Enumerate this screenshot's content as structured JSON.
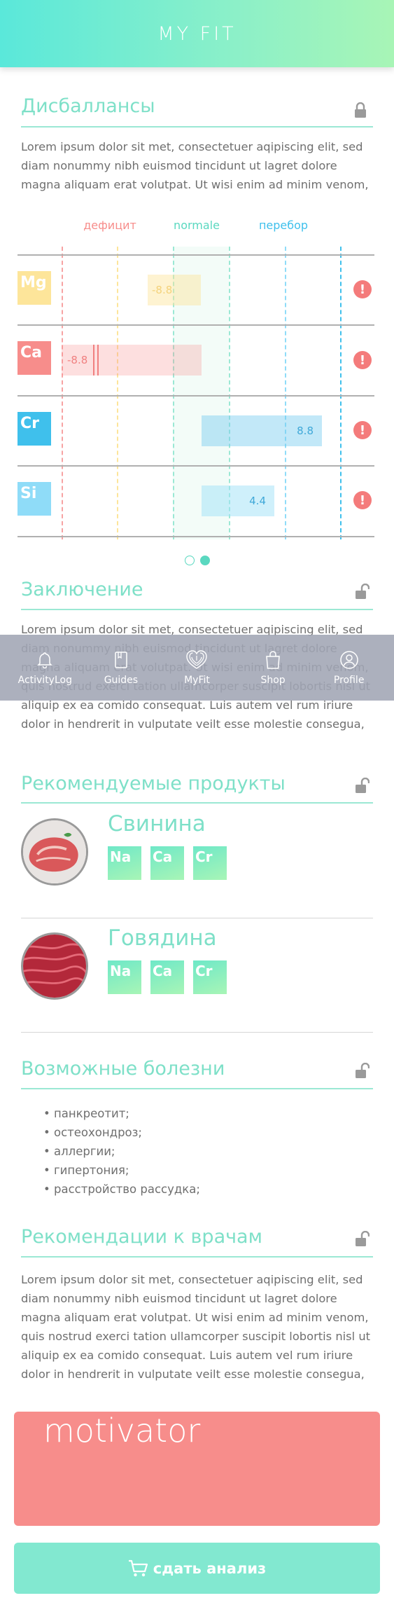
{
  "header": {
    "title": "MY FIT"
  },
  "imbalances": {
    "title": "Дисбаллансы",
    "text": "Lorem ipsum dolor sit met, consectetuer aqipiscing elit, sed diam nonummy nibh euismod tincidunt ut lagret dolore magna aliquam erat volutpat. Ut wisi enim ad minim venom,",
    "zones": {
      "deficit": "дефицит",
      "normal": "normale",
      "excess": "перебор"
    },
    "rows": [
      {
        "element": "Mg",
        "value": "-8.8",
        "color": "#fde59a"
      },
      {
        "element": "Ca",
        "value": "-8.8",
        "color": "#f78d8b"
      },
      {
        "element": "Cr",
        "value": "8.8",
        "color": "#3fc0ec"
      },
      {
        "element": "Si",
        "value": "4.4",
        "color": "#8fdcf8"
      }
    ],
    "warning_icon": "!"
  },
  "conclusion": {
    "title": "Заключение",
    "text": "Lorem ipsum dolor sit met, consectetuer aqipiscing elit, sed diam nonummy nibh euismod tincidunt ut lagret dolore magna aliquam erat volutpat. Ut wisi enim ad minim venom, quis nostrud exerci tation ullamcorper suscipit lobortis nisl ut aliquip ex ea comido consequat. Luis autem vel rum iriure dolor in hendrerit in vulputate veilt esse molestie consegua, vel"
  },
  "nav": [
    {
      "label": "ActivityLog",
      "icon": "bell-icon"
    },
    {
      "label": "Guides",
      "icon": "book-icon"
    },
    {
      "label": "MyFit",
      "icon": "fingerprint-icon"
    },
    {
      "label": "Shop",
      "icon": "bag-icon"
    },
    {
      "label": "Profile",
      "icon": "user-icon"
    }
  ],
  "products": {
    "title": "Рекомендуемые продукты",
    "items": [
      {
        "name": "Свинина",
        "badges": [
          "Na",
          "Ca",
          "Cr"
        ]
      },
      {
        "name": "Говядина",
        "badges": [
          "Na",
          "Ca",
          "Cr"
        ]
      }
    ]
  },
  "diseases": {
    "title": "Возможные болезни",
    "items": [
      "панкреотит;",
      "остеохондроз;",
      "аллергии;",
      "гипертония;",
      "расстройство рассудка;"
    ]
  },
  "doctors": {
    "title": "Рекомендации к врачам",
    "text": "Lorem ipsum dolor sit met, consectetuer aqipiscing elit, sed diam nonummy nibh euismod tincidunt ut lagret dolore magna aliquam erat volutpat. Ut wisi enim ad minim venom, quis nostrud exerci tation ullamcorper suscipit lobortis nisl ut aliquip ex ea comido consequat. Luis autem vel rum iriure dolor in hendrerit in vulputate veilt esse molestie consegua, vel"
  },
  "motivator": {
    "label": "motivator"
  },
  "cta": {
    "label": "сдать анализ",
    "icon": "cart-icon"
  },
  "colors": {
    "accent": "#7ee0c8",
    "deficit": "#f78d8b",
    "excess": "#3fc0ec",
    "motivator": "#f78d8b"
  }
}
